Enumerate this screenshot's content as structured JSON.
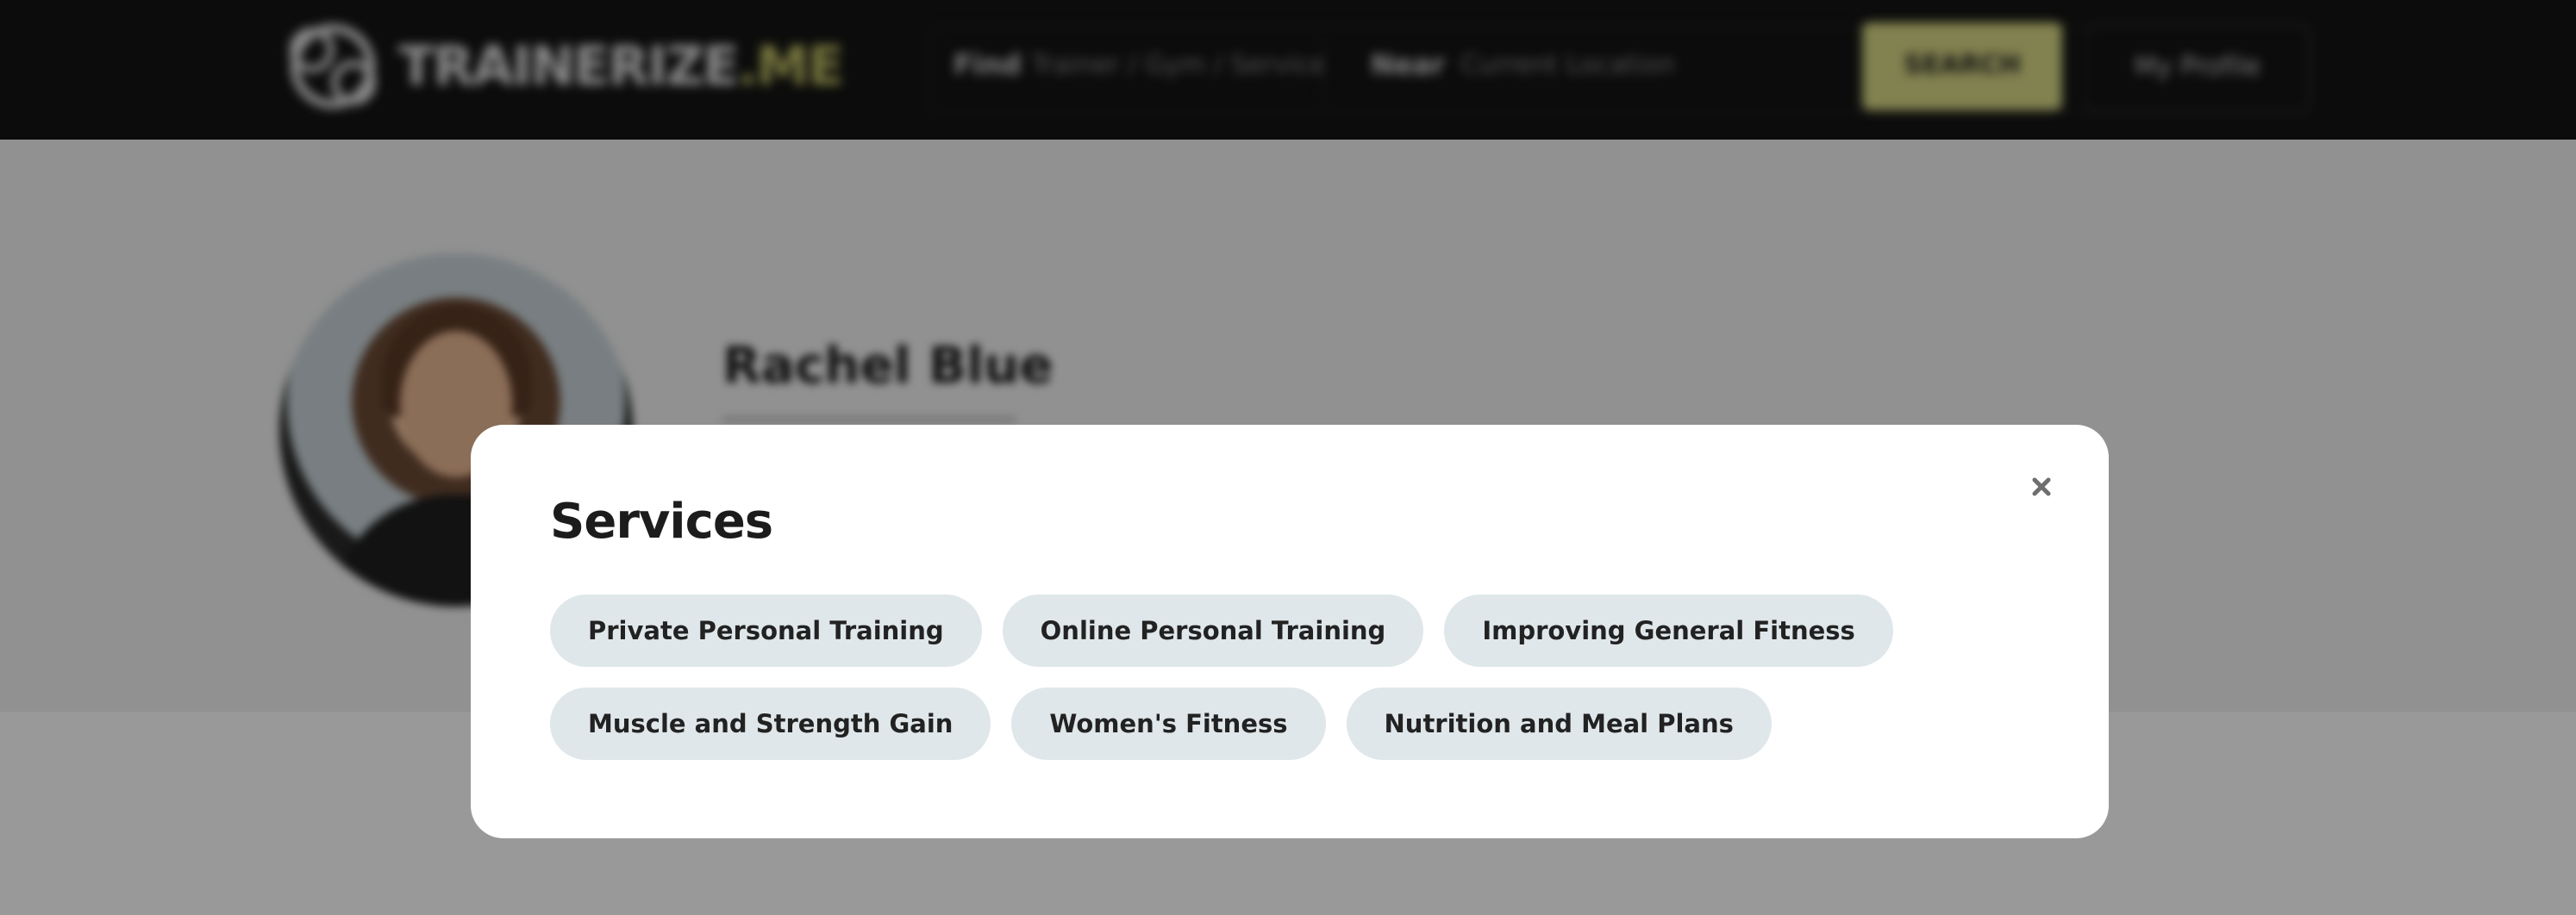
{
  "header": {
    "logo_text_main": "TRAINERIZE",
    "logo_text_accent": ".ME",
    "search_what_label": "Find",
    "search_what_placeholder": "Trainer / Gym / Service",
    "search_where_label": "Near",
    "search_where_placeholder": "Current Location",
    "search_button_label": "SEARCH",
    "login_button_label": "My Profile"
  },
  "profile": {
    "name": "Rachel Blue"
  },
  "modal": {
    "title": "Services",
    "services_rows": [
      [
        "Private Personal Training",
        "Online Personal Training",
        "Improving General Fitness"
      ],
      [
        "Muscle and Strength Gain",
        "Women's Fitness",
        "Nutrition and Meal Plans"
      ]
    ]
  },
  "colors": {
    "header_bg": "#141414",
    "accent": "#d8d986",
    "pill_bg": "#dfe7ea",
    "overlay": "rgba(0,0,0,0.40)"
  },
  "icons": {
    "close": "close-icon",
    "logo": "logo-mark-icon"
  }
}
